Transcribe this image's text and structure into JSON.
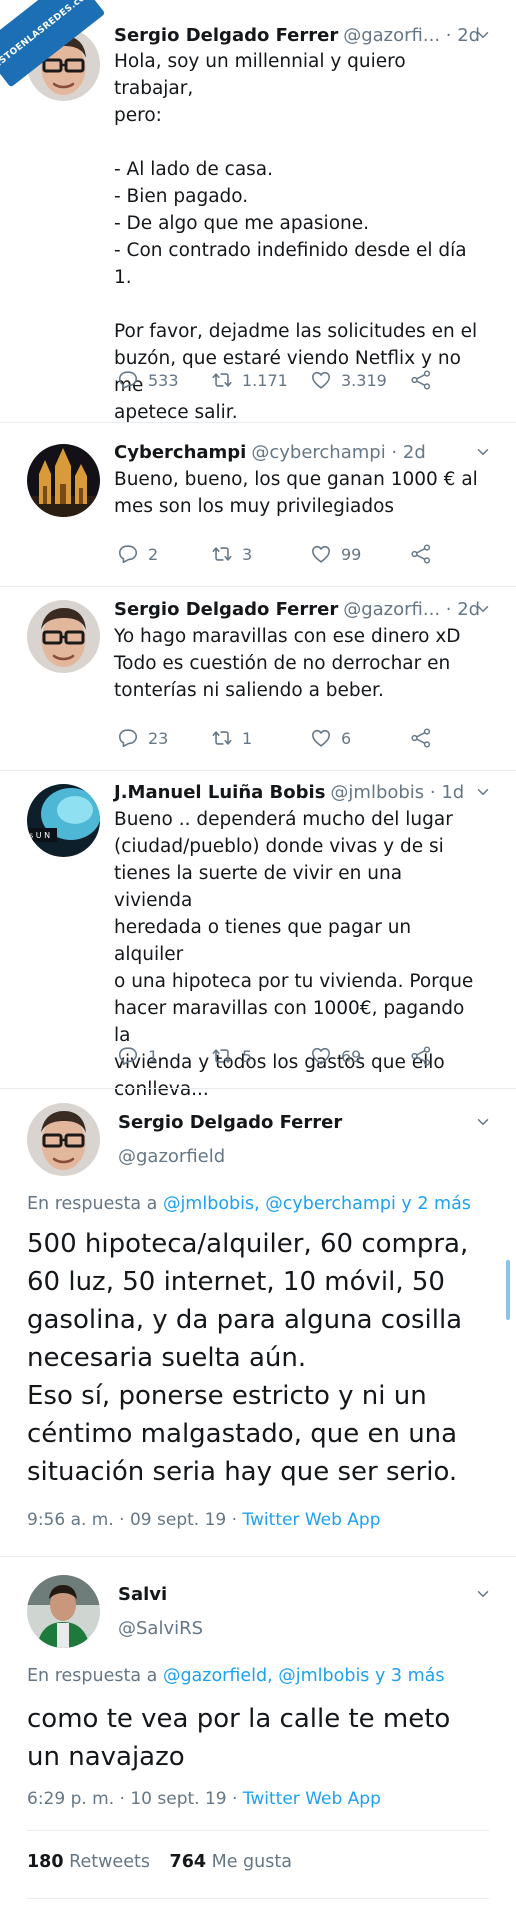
{
  "watermark": "VISTOENLASREDES.com",
  "tweets": [
    {
      "name": "Sergio Delgado Ferrer",
      "handle": "@gazorfi... · 2d",
      "text": "Hola, soy un millennial y quiero trabajar,\npero:\n\n- Al lado de casa.\n- Bien pagado.\n- De algo que me apasione.\n- Con contrado indefinido desde el día 1.\n\nPor favor, dejadme las solicitudes en el\nbuzón, que estaré viendo Netflix y no me\napetece salir.",
      "replies": "533",
      "retweets": "1.171",
      "likes": "3.319"
    },
    {
      "name": "Cyberchampi",
      "handle": "@cyberchampi · 2d",
      "text": "Bueno, bueno, los que ganan 1000 € al\nmes son los muy privilegiados",
      "replies": "2",
      "retweets": "3",
      "likes": "99"
    },
    {
      "name": "Sergio Delgado Ferrer",
      "handle": "@gazorfi... · 2d",
      "text": "Yo hago maravillas con ese dinero xD\nTodo es cuestión de no derrochar en\ntonterías ni saliendo a beber.",
      "replies": "23",
      "retweets": "1",
      "likes": "6"
    },
    {
      "name": "J.Manuel Luiña Bobis",
      "handle": "@jmlbobis · 1d",
      "text": "Bueno .. dependerá mucho del lugar\n(ciudad/pueblo) donde vivas y de si\ntienes la suerte de vivir en una vivienda\nheredada o tienes que pagar un alquiler\no una hipoteca por tu vivienda. Porque\nhacer maravillas con 1000€, pagando la\nvivienda y todos los gastos que ello\nconlleva...",
      "replies": "1",
      "retweets": "5",
      "likes": "69"
    }
  ],
  "detail1": {
    "name": "Sergio Delgado Ferrer",
    "handle": "@gazorfield",
    "reply_prefix": "En respuesta a ",
    "reply_mentions": "@jmlbobis, @cyberchampi y 2 más",
    "text": "500 hipoteca/alquiler, 60 compra,\n60 luz, 50 internet, 10 móvil, 50\ngasolina, y da para alguna cosilla\nnecesaria suelta aún.\nEso sí, ponerse estricto y ni un\ncéntimo malgastado, que en una\nsituación seria hay que ser serio.",
    "time": "9:56 a. m. · 09 sept. 19 · ",
    "app": "Twitter Web App"
  },
  "detail2": {
    "name": "Salvi",
    "handle": "@SalviRS",
    "reply_prefix": "En respuesta a ",
    "reply_mentions": "@gazorfield, @jmlbobis y 3 más",
    "text": "como te vea por la calle te meto\nun navajazo",
    "time": "6:29 p. m. · 10 sept. 19 · ",
    "app": "Twitter Web App",
    "retweets_count": "180",
    "retweets_label": "Retweets",
    "likes_count": "764",
    "likes_label": "Me gusta"
  },
  "colors": {
    "link": "#1da1f2",
    "secondary": "#657786",
    "divider": "#e6ecf0"
  },
  "icons": [
    "reply-icon",
    "retweet-icon",
    "like-icon",
    "share-icon",
    "chevron-down-icon"
  ]
}
